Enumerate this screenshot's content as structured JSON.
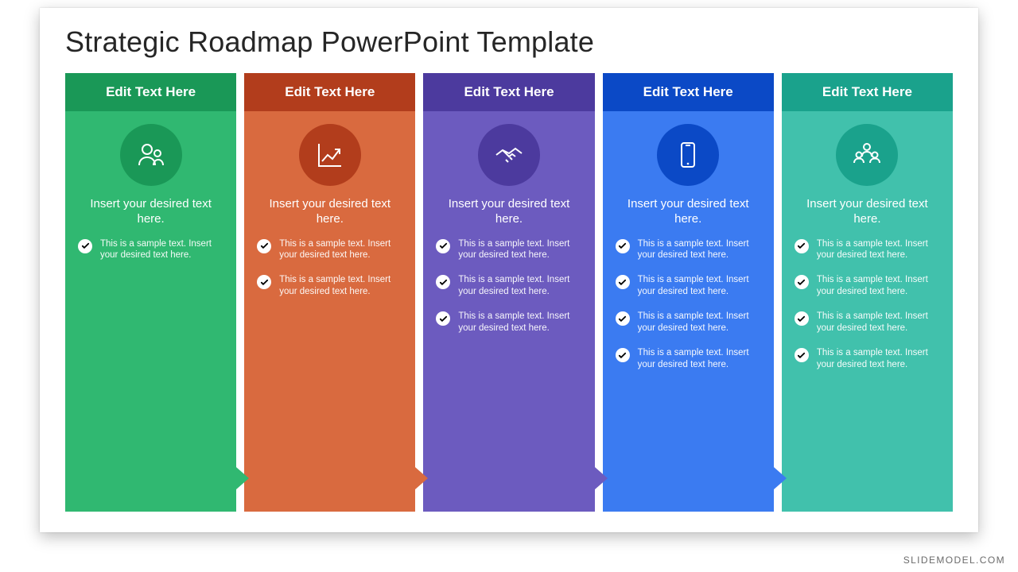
{
  "title": "Strategic Roadmap PowerPoint Template",
  "watermark": "SLIDEMODEL.COM",
  "sample_bullet": "This is a sample text. Insert your desired text here.",
  "columns": [
    {
      "header": "Edit Text Here",
      "subtitle": "Insert your desired text here.",
      "icon": "people-icon",
      "bullet_count": 1,
      "head_color": "#1a9857",
      "body_color": "#30b871",
      "circle_color": "#1a9857"
    },
    {
      "header": "Edit Text Here",
      "subtitle": "Insert your desired text here.",
      "icon": "growth-chart-icon",
      "bullet_count": 2,
      "head_color": "#b23d1c",
      "body_color": "#d96a3f",
      "circle_color": "#b23d1c"
    },
    {
      "header": "Edit Text Here",
      "subtitle": "Insert your desired text here.",
      "icon": "handshake-icon",
      "bullet_count": 3,
      "head_color": "#4c3a9e",
      "body_color": "#6c5bbf",
      "circle_color": "#4c3a9e"
    },
    {
      "header": "Edit Text Here",
      "subtitle": "Insert your desired text here.",
      "icon": "smartphone-icon",
      "bullet_count": 4,
      "head_color": "#0b49c6",
      "body_color": "#3b7bf1",
      "circle_color": "#0b49c6"
    },
    {
      "header": "Edit Text Here",
      "subtitle": "Insert your desired text here.",
      "icon": "team-icon",
      "bullet_count": 4,
      "head_color": "#1aa28c",
      "body_color": "#41c1ac",
      "circle_color": "#1aa28c"
    }
  ]
}
